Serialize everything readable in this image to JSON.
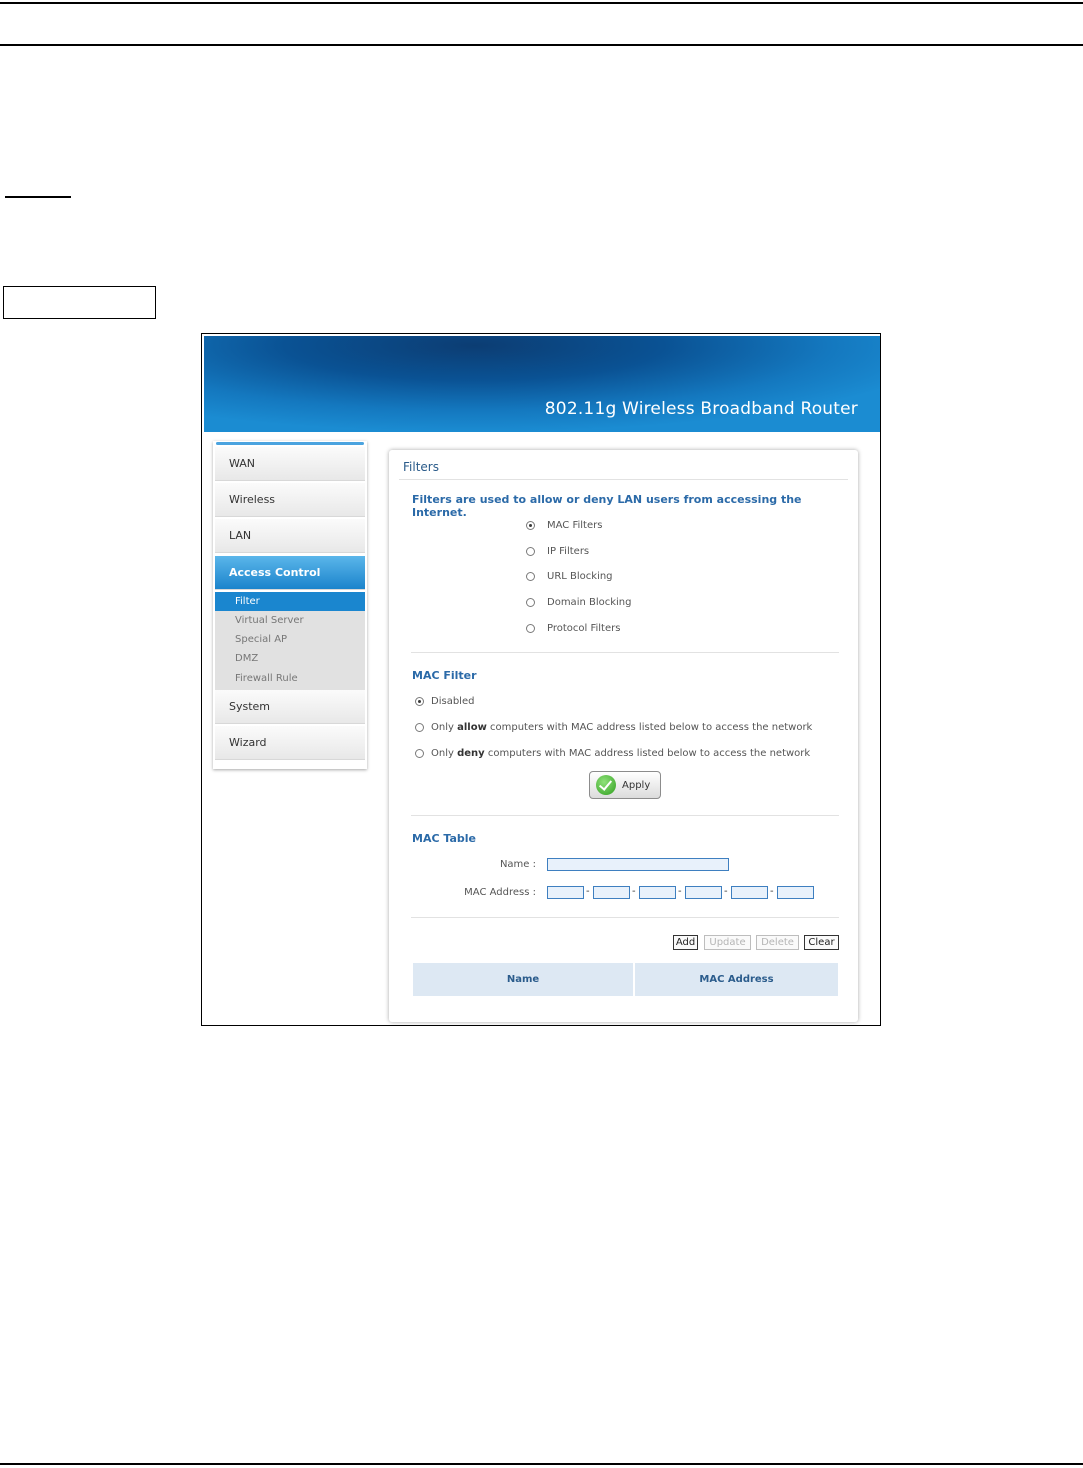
{
  "banner": {
    "title": "802.11g Wireless Broadband Router"
  },
  "sidebar": {
    "items": [
      {
        "label": "WAN"
      },
      {
        "label": "Wireless"
      },
      {
        "label": "LAN"
      },
      {
        "label": "Access Control"
      },
      {
        "label": "System"
      },
      {
        "label": "Wizard"
      }
    ],
    "active": "Access Control",
    "subitems": [
      {
        "label": "Filter"
      },
      {
        "label": "Virtual Server"
      },
      {
        "label": "Special AP"
      },
      {
        "label": "DMZ"
      },
      {
        "label": "Firewall Rule"
      }
    ],
    "active_subitem": "Filter"
  },
  "panel": {
    "title": "Filters",
    "intro": "Filters are used to allow or deny LAN users from accessing the Internet.",
    "filter_types": [
      {
        "label": "MAC Filters",
        "checked": true
      },
      {
        "label": "IP Filters",
        "checked": false
      },
      {
        "label": "URL Blocking",
        "checked": false
      },
      {
        "label": "Domain Blocking",
        "checked": false
      },
      {
        "label": "Protocol Filters",
        "checked": false
      }
    ]
  },
  "mac_filter": {
    "title": "MAC Filter",
    "disabled_label": "Disabled",
    "only": "Only",
    "allow_word": "allow",
    "deny_word": "deny",
    "rest_text": "computers with MAC address listed below to access the network",
    "selected": "disabled",
    "apply_label": "Apply"
  },
  "mac_table": {
    "title": "MAC Table",
    "name_label": "Name :",
    "mac_label": "MAC Address :",
    "name_value": "",
    "mac_octets": [
      "",
      "",
      "",
      "",
      "",
      ""
    ],
    "separator": "-",
    "buttons": {
      "add": "Add",
      "update": "Update",
      "delete": "Delete",
      "clear": "Clear"
    },
    "columns": [
      "Name",
      "MAC Address"
    ]
  }
}
